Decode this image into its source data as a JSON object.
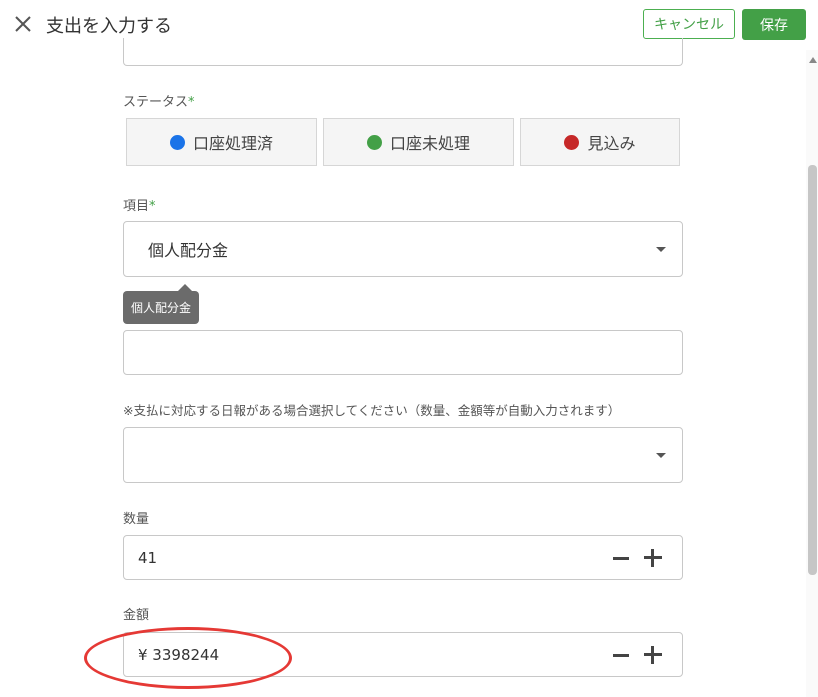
{
  "header": {
    "title": "支出を入力する",
    "cancel_label": "キャンセル",
    "save_label": "保存",
    "close_icon": "close-icon"
  },
  "status": {
    "label": "ステータス",
    "required_mark": "*",
    "options": [
      {
        "label": "口座処理済",
        "color": "#1a73e8"
      },
      {
        "label": "口座未処理",
        "color": "#43a047"
      },
      {
        "label": "見込み",
        "color": "#c62828"
      }
    ]
  },
  "item": {
    "label": "項目",
    "required_mark": "*",
    "value": "個人配分金",
    "tooltip": "個人配分金"
  },
  "daily_report": {
    "hint": "※支払に対応する日報がある場合選択してください（数量、金額等が自動入力されます）",
    "value": ""
  },
  "quantity": {
    "label": "数量",
    "value": "41"
  },
  "amount": {
    "label": "金額",
    "value": "¥ 3398244"
  },
  "colors": {
    "accent": "#43a047",
    "annotation": "#e53935"
  }
}
